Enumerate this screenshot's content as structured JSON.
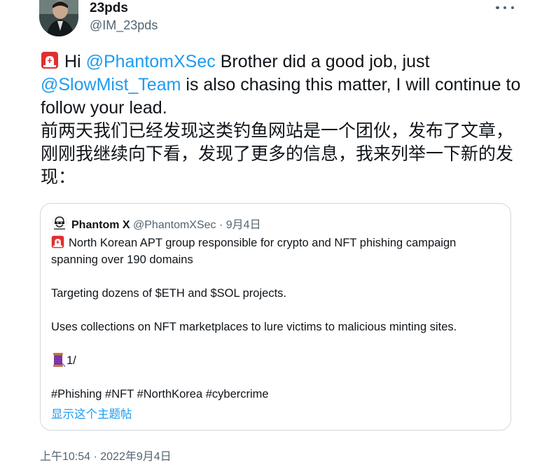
{
  "author": {
    "display_name": "23pds",
    "handle": "@IM_23pds"
  },
  "tweet": {
    "mention_1": "@PhantomXSec",
    "text_1": " Brother did a good job, just ",
    "text_hi": "Hi ",
    "mention_2": "@SlowMist_Team",
    "text_2": "  is also chasing this matter, I will continue to follow your lead.",
    "text_cn": "前两天我们已经发现这类钓鱼网站是一个团伙，发布了文章，刚刚我继续向下看，发现了更多的信息，我来列举一下新的发现："
  },
  "quoted": {
    "name": "Phantom X",
    "handle": "@PhantomXSec",
    "separator": " · ",
    "date": "9月4日",
    "line_1": "North Korean APT group responsible for crypto and NFT phishing campaign spanning over 190 domains",
    "line_2": "Targeting dozens of $ETH and $SOL projects.",
    "line_3": "Uses collections on NFT marketplaces to lure victims to malicious minting sites.",
    "line_4": "1/",
    "hashtags": "#Phishing #NFT #NorthKorea #cybercrime",
    "show_thread": "显示这个主题帖"
  },
  "timestamp": "上午10:54 · 2022年9月4日",
  "icons": {
    "menu": "more-horizontal-icon",
    "siren": "rotating-light-icon",
    "thread": "thread-spool-icon"
  },
  "colors": {
    "link": "#1d9bf0",
    "text": "#0f1419",
    "secondary": "#536471",
    "border": "#cfd9de",
    "siren_red": "#e0302f"
  }
}
